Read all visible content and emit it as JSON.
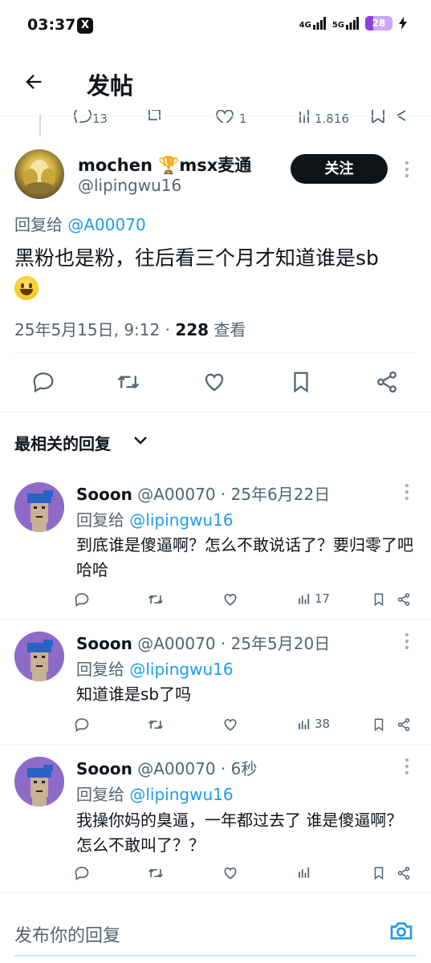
{
  "status_bar": {
    "time": "03:37",
    "x_app_glyph": "X",
    "network_1": "4G",
    "network_2": "5G",
    "battery": "28",
    "battery_level_percent": 28
  },
  "header": {
    "title": "发帖",
    "back_icon": "arrow-left-icon"
  },
  "main_tweet": {
    "display_name": "mochen 🏆msx麦通",
    "handle": "@lipingwu16",
    "follow_label": "关注",
    "reply_to_prefix": "回复给",
    "reply_to_handle": "@A00070",
    "text": "黑粉也是粉，往后看三个月才知道谁是sb",
    "emoji": "grinning-face-emoji",
    "date": "25年5月15日, 9:12 · ",
    "views_count": "228",
    "views_label": "查看"
  },
  "sort": {
    "label": "最相关的回复"
  },
  "replies": [
    {
      "name": "Sooon",
      "handle_time": "@A00070 · 25年6月22日",
      "reply_to_prefix": "回复给",
      "reply_to_handle": "@lipingwu16",
      "text": "到底谁是傻逼啊？怎么不敢说话了？要归零了吧 哈哈",
      "views": "17"
    },
    {
      "name": "Sooon",
      "handle_time": "@A00070 · 25年5月20日",
      "reply_to_prefix": "回复给",
      "reply_to_handle": "@lipingwu16",
      "text": "知道谁是sb了吗",
      "views": "38"
    },
    {
      "name": "Sooon",
      "handle_time": "@A00070 · 6秒",
      "reply_to_prefix": "回复给",
      "reply_to_handle": "@lipingwu16",
      "text": "我操你妈的臭逼，一年都过去了 谁是傻逼啊？怎么不敢叫了？？",
      "views": ""
    }
  ],
  "composer": {
    "placeholder": "发布你的回复"
  },
  "colors": {
    "accent": "#1d9bf0",
    "text_primary": "#0f1419",
    "text_secondary": "#536471",
    "avatar_bg": "#8e6bc9"
  }
}
